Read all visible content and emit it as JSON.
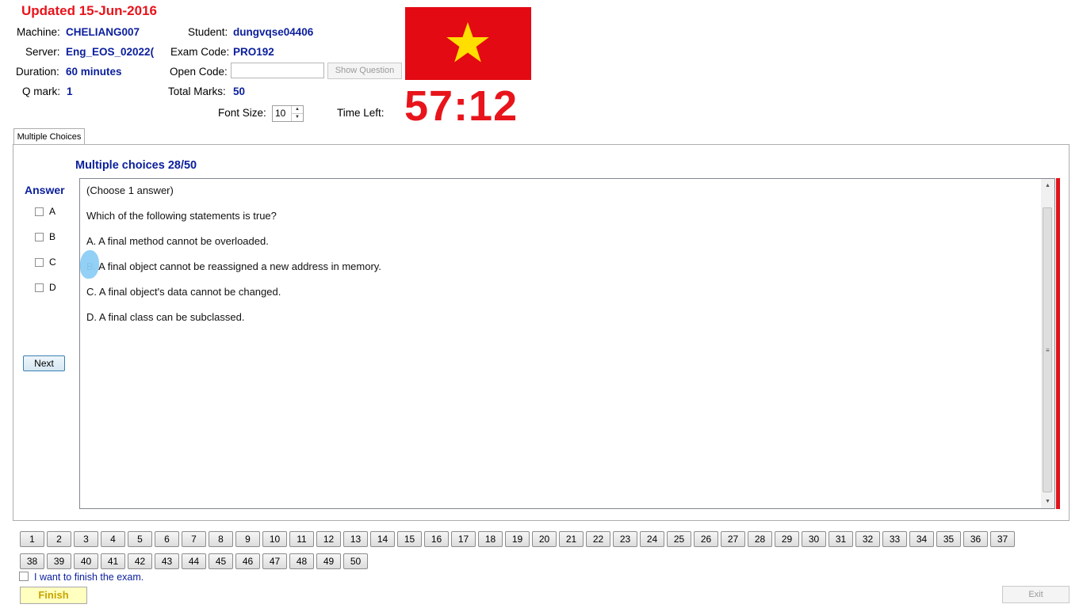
{
  "header": {
    "updated": "Updated 15-Jun-2016",
    "machine_label": "Machine:",
    "machine_value": "CHELIANG007",
    "server_label": "Server:",
    "server_value": "Eng_EOS_02022(",
    "duration_label": "Duration:",
    "duration_value": "60 minutes",
    "qmark_label": "Q mark:",
    "qmark_value": "1",
    "student_label": "Student:",
    "student_value": "dungvqse04406",
    "exam_code_label": "Exam Code:",
    "exam_code_value": "PRO192",
    "open_code_label": "Open Code:",
    "open_code_value": "",
    "show_question_label": "Show Question",
    "total_marks_label": "Total Marks:",
    "total_marks_value": "50",
    "font_size_label": "Font Size:",
    "font_size_value": "10",
    "time_left_label": "Time Left:",
    "time_left_value": "57:12"
  },
  "colors": {
    "accent_blue": "#0a1e9c",
    "timer_red": "#e8141b",
    "flag_red": "#e30a13",
    "flag_star": "#ffde00"
  },
  "tabs": [
    {
      "label": "Multiple Choices"
    }
  ],
  "question": {
    "title": "Multiple choices 28/50",
    "lines": [
      "(Choose 1 answer)",
      "Which of the following statements is true?",
      "A.  A final method cannot be overloaded.",
      "B.  A final object cannot be reassigned a new address in memory.",
      "C.  A final object's data cannot be changed.",
      "D.  A final class can be subclassed."
    ]
  },
  "answer": {
    "label": "Answer",
    "options": [
      "A",
      "B",
      "C",
      "D"
    ],
    "next_label": "Next"
  },
  "navigation": {
    "row1": [
      "1",
      "2",
      "3",
      "4",
      "5",
      "6",
      "7",
      "8",
      "9",
      "10",
      "11",
      "12",
      "13",
      "14",
      "15",
      "16",
      "17",
      "18",
      "19",
      "20",
      "21",
      "22",
      "23",
      "24",
      "25",
      "26",
      "27",
      "28",
      "29",
      "30",
      "31",
      "32",
      "33",
      "34",
      "35",
      "36",
      "37"
    ],
    "row2": [
      "38",
      "39",
      "40",
      "41",
      "42",
      "43",
      "44",
      "45",
      "46",
      "47",
      "48",
      "49",
      "50"
    ]
  },
  "footer": {
    "finish_check_label": "I want to finish the exam.",
    "finish_label": "Finish",
    "exit_label": "Exit"
  }
}
